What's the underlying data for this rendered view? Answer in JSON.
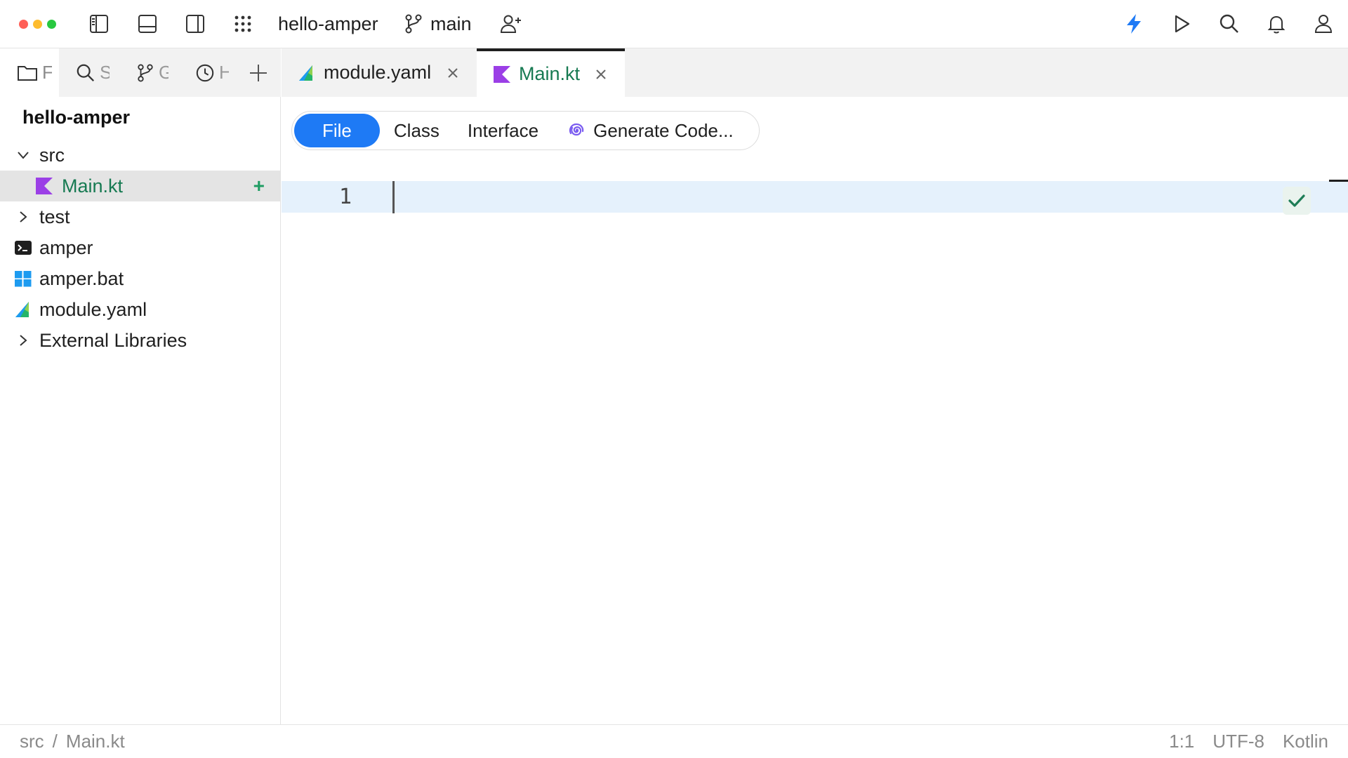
{
  "titlebar": {
    "project_name": "hello-amper",
    "branch": "main"
  },
  "tool_tabs": [
    {
      "label": "F",
      "icon": "folder-icon"
    },
    {
      "label": "S",
      "icon": "search-icon"
    },
    {
      "label": "G",
      "icon": "git-branch-icon"
    },
    {
      "label": "H",
      "icon": "clock-icon"
    }
  ],
  "project": {
    "title": "hello-amper",
    "tree": [
      {
        "label": "src",
        "icon": "chevron-down-icon"
      },
      {
        "label": "Main.kt",
        "icon": "kotlin-file-icon"
      },
      {
        "label": "test",
        "icon": "chevron-right-icon"
      },
      {
        "label": "amper",
        "icon": "terminal-icon"
      },
      {
        "label": "amper.bat",
        "icon": "windows-icon"
      },
      {
        "label": "module.yaml",
        "icon": "amper-icon"
      },
      {
        "label": "External Libraries",
        "icon": "chevron-right-icon"
      }
    ],
    "add_label": "+"
  },
  "editor_tabs": [
    {
      "label": "module.yaml",
      "icon": "amper-icon"
    },
    {
      "label": "Main.kt",
      "icon": "kotlin-file-icon"
    }
  ],
  "new_bar": {
    "file": "File",
    "class": "Class",
    "interface": "Interface",
    "generate": "Generate Code..."
  },
  "editor": {
    "line_number": "1"
  },
  "statusbar": {
    "breadcrumb": [
      "src",
      "/",
      "Main.kt"
    ],
    "position": "1:1",
    "encoding": "UTF-8",
    "language": "Kotlin"
  },
  "colors": {
    "accent": "#1e7af5",
    "selected_text": "#177a52",
    "kotlin": "#9b3fe6",
    "line_highlight": "#e5f1fc"
  }
}
